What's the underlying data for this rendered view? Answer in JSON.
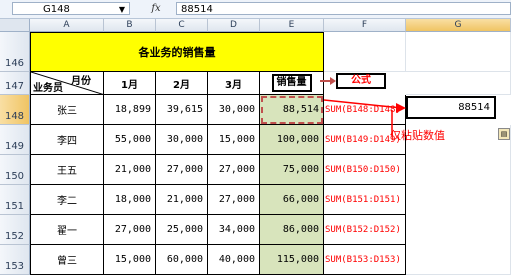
{
  "formula_bar": {
    "cell_ref": "G148",
    "fx_symbol": "fx",
    "value": "88514"
  },
  "columns": [
    "A",
    "B",
    "C",
    "D",
    "E",
    "F",
    "G"
  ],
  "rows": [
    "146",
    "147",
    "148",
    "149",
    "150",
    "151",
    "152",
    "153"
  ],
  "sheet": {
    "title": "各业务的销售量",
    "header_corner_top": "月份",
    "header_corner_bottom": "业务员",
    "headers": [
      "1月",
      "2月",
      "3月",
      "销售量"
    ],
    "formula_tag": "公式",
    "data_rows": [
      {
        "name": "张三",
        "m1": "18,899",
        "m2": "39,615",
        "m3": "30,000",
        "total": "88,514",
        "formula": "SUM(B148:D148)"
      },
      {
        "name": "李四",
        "m1": "55,000",
        "m2": "30,000",
        "m3": "15,000",
        "total": "100,000",
        "formula": "SUM(B149:D149)"
      },
      {
        "name": "王五",
        "m1": "21,000",
        "m2": "27,000",
        "m3": "27,000",
        "total": "75,000",
        "formula": "SUM(B150:D150)"
      },
      {
        "name": "李二",
        "m1": "18,000",
        "m2": "21,000",
        "m3": "27,000",
        "total": "66,000",
        "formula": "SUM(B151:D151)"
      },
      {
        "name": "翟一",
        "m1": "27,000",
        "m2": "25,000",
        "m3": "34,000",
        "total": "86,000",
        "formula": "SUM(B152:D152)"
      },
      {
        "name": "曾三",
        "m1": "15,000",
        "m2": "60,000",
        "m3": "40,000",
        "total": "115,000",
        "formula": "SUM(B153:D153)"
      }
    ],
    "pasted_value": "88514",
    "paste_note": "仅粘贴数值"
  },
  "colors": {
    "title_bg": "#ffff00",
    "total_bg": "#d8e4bc",
    "annotation": "#ff0000"
  }
}
